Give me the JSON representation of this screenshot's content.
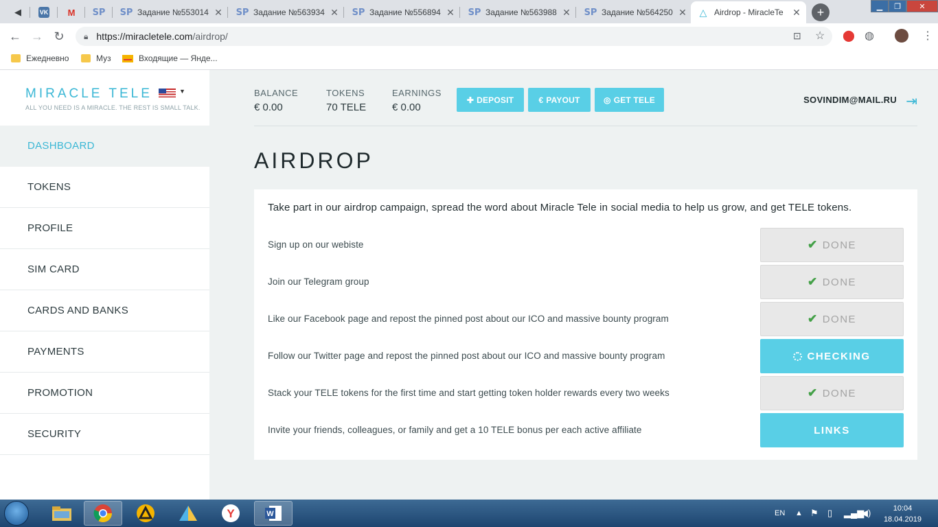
{
  "browser": {
    "tabs": [
      {
        "title": "",
        "favicon": "speaker-icon"
      },
      {
        "title": "",
        "favicon": "vk-icon"
      },
      {
        "title": "",
        "favicon": "gmail-icon"
      },
      {
        "title": "",
        "favicon": "sp-icon"
      },
      {
        "title": "Задание №553014",
        "favicon": "sp-icon"
      },
      {
        "title": "Задание №563934",
        "favicon": "sp-icon"
      },
      {
        "title": "Задание №556894",
        "favicon": "sp-icon"
      },
      {
        "title": "Задание №563988",
        "favicon": "sp-icon"
      },
      {
        "title": "Задание №564250",
        "favicon": "sp-icon"
      },
      {
        "title": "Airdrop - MiracleTe",
        "favicon": "miracletele-icon"
      }
    ],
    "url_host": "https://miracletele.com",
    "url_path": "/airdrop/",
    "bookmarks": [
      "Ежедневно",
      "Муз",
      "Входящие — Янде..."
    ]
  },
  "sidebar": {
    "logo": "MIRACLE TELE",
    "tagline": "ALL YOU NEED IS A MIRACLE. THE REST IS SMALL TALK.",
    "menu": [
      "DASHBOARD",
      "TOKENS",
      "PROFILE",
      "SIM CARD",
      "CARDS AND BANKS",
      "PAYMENTS",
      "PROMOTION",
      "SECURITY"
    ]
  },
  "topbar": {
    "balance_label": "BALANCE",
    "balance_value": "€ 0.00",
    "tokens_label": "TOKENS",
    "tokens_value": "70 TELE",
    "earnings_label": "EARNINGS",
    "earnings_value": "€ 0.00",
    "deposit": "DEPOSIT",
    "payout": "PAYOUT",
    "get_tele": "GET TELE",
    "email": "SOVINDIM@MAIL.RU"
  },
  "page_title": "AIRDROP",
  "intro": "Take part in our airdrop campaign, spread the word about Miracle Tele in social media to help us grow, and get TELE tokens.",
  "tasks": [
    {
      "text": "Sign up on our webiste",
      "button": "DONE",
      "state": "done"
    },
    {
      "text": "Join our Telegram group",
      "button": "DONE",
      "state": "done"
    },
    {
      "text": "Like our Facebook page and repost the pinned post about our ICO and massive bounty program",
      "button": "DONE",
      "state": "done"
    },
    {
      "text": "Follow our Twitter page and repost the pinned post about our ICO and massive bounty program",
      "button": "CHECKING",
      "state": "checking"
    },
    {
      "text": "Stack your TELE tokens for the first time and start getting token holder rewards every two weeks",
      "button": "DONE",
      "state": "done"
    },
    {
      "text": "Invite your friends, colleagues, or family and get a 10 TELE bonus per each active affiliate",
      "button": "LINKS",
      "state": "links"
    }
  ],
  "taskbar": {
    "lang": "EN",
    "time": "10:04",
    "date": "18.04.2019"
  },
  "colors": {
    "accent": "#59cfe6",
    "accent_text": "#3ab7d5",
    "done_check": "#43a047"
  }
}
